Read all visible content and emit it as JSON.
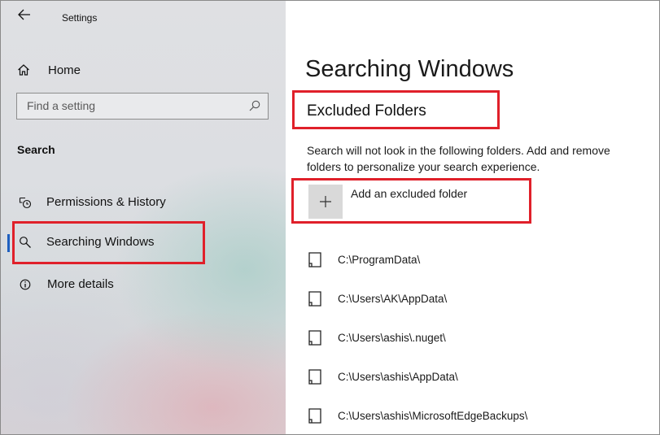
{
  "app": {
    "title": "Settings"
  },
  "nav": {
    "home_label": "Home",
    "search_placeholder": "Find a setting",
    "section_heading": "Search",
    "items": [
      {
        "label": "Permissions & History",
        "icon": "permissions-history-icon",
        "selected": false
      },
      {
        "label": "Searching Windows",
        "icon": "search-icon",
        "selected": true
      },
      {
        "label": "More details",
        "icon": "info-icon",
        "selected": false
      }
    ]
  },
  "main": {
    "page_title": "Searching Windows",
    "subheading": "Excluded Folders",
    "description_line1": "Search will not look in the following folders. Add and remove",
    "description_line2": "folders to personalize your search experience.",
    "add_label": "Add an excluded folder",
    "folders": [
      "C:\\ProgramData\\",
      "C:\\Users\\AK\\AppData\\",
      "C:\\Users\\ashis\\.nuget\\",
      "C:\\Users\\ashis\\AppData\\",
      "C:\\Users\\ashis\\MicrosoftEdgeBackups\\"
    ]
  },
  "colors": {
    "highlight": "#e0202a",
    "selection_accent": "#1e5fbf",
    "add_button_bg": "#d9d9d9"
  }
}
